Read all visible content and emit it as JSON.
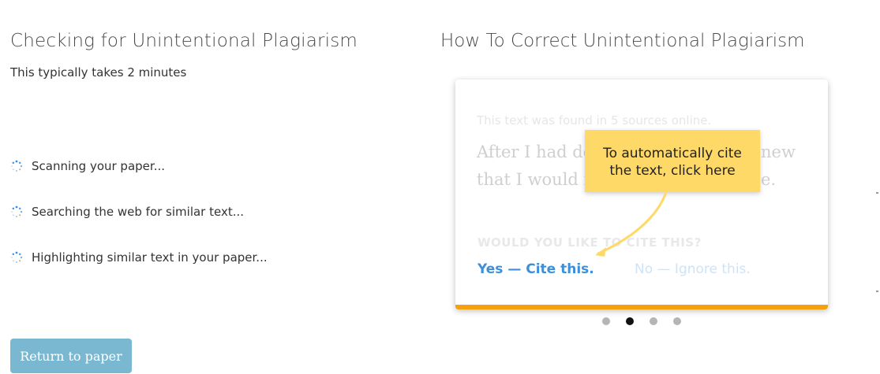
{
  "left": {
    "title": "Checking for Unintentional Plagiarism",
    "subtitle": "This typically takes 2 minutes",
    "steps": [
      {
        "label": "Scanning your paper...",
        "icon": "loading-spinner-icon"
      },
      {
        "label": "Searching the web for similar text...",
        "icon": "loading-spinner-icon"
      },
      {
        "label": "Highlighting similar text in your paper...",
        "icon": "loading-spinner-icon"
      }
    ],
    "return_button": "Return to paper"
  },
  "right": {
    "title": "How To Correct Unintentional Plagiarism",
    "card": {
      "source_note": "This text was found in 5 sources online.",
      "line1_start": "After I had do",
      "line1_end": "new",
      "line2_start": "that I would n",
      "line2_end": "e.",
      "question": "WOULD YOU LIKE TO CITE THIS?",
      "yes_option": "Yes — Cite this.",
      "no_option": "No — Ignore this."
    },
    "tooltip": {
      "line1": "To automatically cite",
      "line2": "the text, click here"
    },
    "carousel": {
      "total": 4,
      "active_index": 1
    }
  },
  "colors": {
    "accent_blue": "#3d8fd9",
    "button_blue": "#7ab8d1",
    "card_bottom_orange": "#f5a00c",
    "tooltip_yellow": "#ffd968"
  }
}
